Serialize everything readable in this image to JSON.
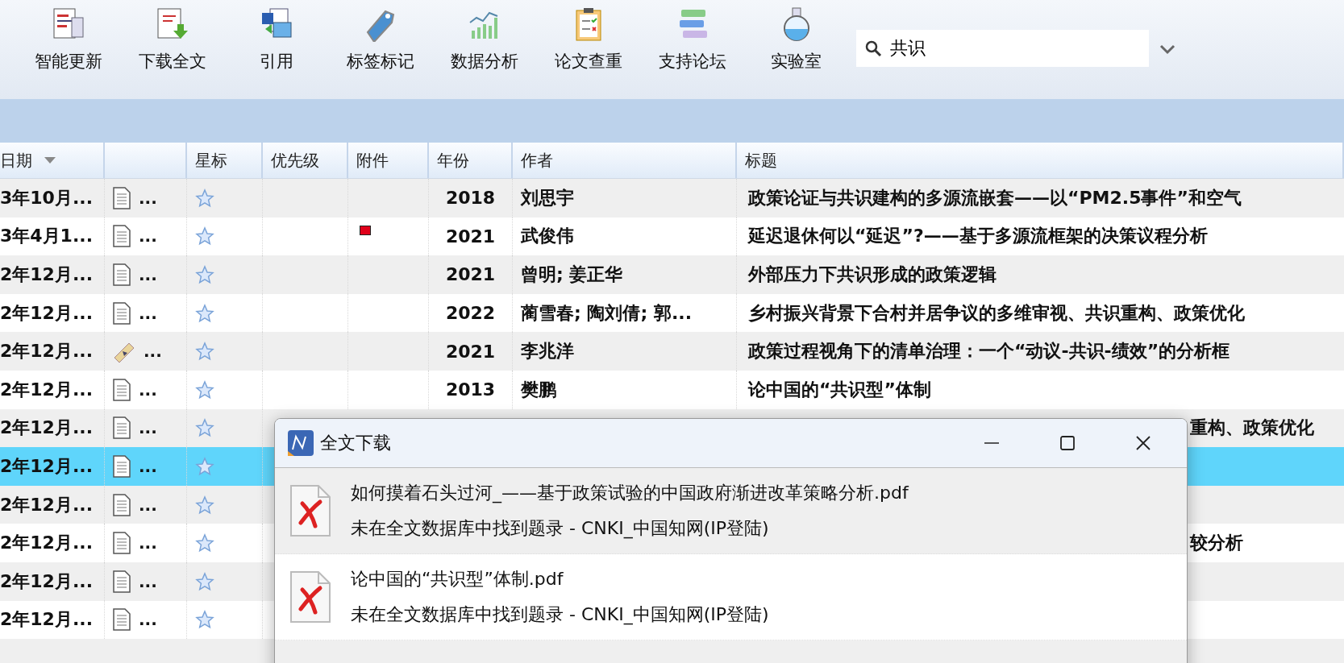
{
  "toolbar": {
    "buttons": [
      {
        "label": "智能更新",
        "kind": "update"
      },
      {
        "label": "下载全文",
        "kind": "download"
      },
      {
        "label": "引用",
        "kind": "cite"
      },
      {
        "label": "标签标记",
        "kind": "tag"
      },
      {
        "label": "数据分析",
        "kind": "chart"
      },
      {
        "label": "论文查重",
        "kind": "check"
      },
      {
        "label": "支持论坛",
        "kind": "forum"
      },
      {
        "label": "实验室",
        "kind": "lab"
      }
    ],
    "search": {
      "value": "共识"
    }
  },
  "table": {
    "columns": [
      {
        "label": "日期",
        "sorted": true
      },
      {
        "sorted": false
      },
      {
        "label": "星标",
        "sorted": false
      },
      {
        "label": "优先级",
        "sorted": false
      },
      {
        "label": "附件",
        "sorted": false
      },
      {
        "label": "年份",
        "sorted": false
      },
      {
        "label": "作者",
        "sorted": false
      },
      {
        "label": "标题",
        "sorted": false
      }
    ],
    "rows": [
      {
        "date": "3年10月...",
        "kind": "doc",
        "more": "...",
        "year": "2018",
        "author": "刘思宇",
        "title": "政策论证与共识建构的多源流嵌套——以“PM2.5事件”和空气",
        "attachment": false,
        "selected": false,
        "covered": false
      },
      {
        "date": "3年4月1...",
        "kind": "doc",
        "more": "...",
        "year": "2021",
        "author": "武俊伟",
        "title": "延迟退休何以“延迟”?——基于多源流框架的决策议程分析",
        "attachment": true,
        "selected": false,
        "covered": false
      },
      {
        "date": "2年12月...",
        "kind": "doc",
        "more": "...",
        "year": "2021",
        "author": "曾明; 姜正华",
        "title": "外部压力下共识形成的政策逻辑",
        "attachment": false,
        "selected": false,
        "covered": false
      },
      {
        "date": "2年12月...",
        "kind": "doc",
        "more": "...",
        "year": "2022",
        "author": "蔺雪春; 陶刘倩; 郭...",
        "title": "乡村振兴背景下合村并居争议的多维审视、共识重构、政策优化",
        "attachment": false,
        "selected": false,
        "covered": false
      },
      {
        "date": "2年12月...",
        "kind": "thesis",
        "more": "...",
        "year": "2021",
        "author": "李兆洋",
        "title": "政策过程视角下的清单治理：一个“动议-共识-绩效”的分析框",
        "attachment": false,
        "selected": false,
        "covered": false
      },
      {
        "date": "2年12月...",
        "kind": "doc",
        "more": "...",
        "year": "2013",
        "author": "樊鹏",
        "title": "论中国的“共识型”体制",
        "attachment": false,
        "selected": false,
        "covered": false
      },
      {
        "date": "2年12月...",
        "kind": "doc",
        "more": "...",
        "title": "重构、政策优化",
        "selected": false,
        "covered": true
      },
      {
        "date": "2年12月...",
        "kind": "doc",
        "more": "...",
        "selected": true
      },
      {
        "date": "2年12月...",
        "kind": "doc",
        "more": "...",
        "selected": false
      },
      {
        "date": "2年12月...",
        "kind": "doc",
        "more": "...",
        "title": "较分析",
        "selected": false,
        "covered": true
      },
      {
        "date": "2年12月...",
        "kind": "doc",
        "more": "...",
        "selected": false
      },
      {
        "date": "2年12月...",
        "kind": "doc",
        "more": "...",
        "selected": false
      }
    ]
  },
  "dialog": {
    "title": "全文下载",
    "items": [
      {
        "file": "如何摸着石头过河_——基于政策试验的中国政府渐进改革策略分析.pdf",
        "status": "未在全文数据库中找到题录  -  CNKI_中国知网(IP登陆)",
        "failed": true
      },
      {
        "file": "论中国的“共识型”体制.pdf",
        "status": "未在全文数据库中找到题录  -  CNKI_中国知网(IP登陆)",
        "failed": true
      }
    ]
  }
}
